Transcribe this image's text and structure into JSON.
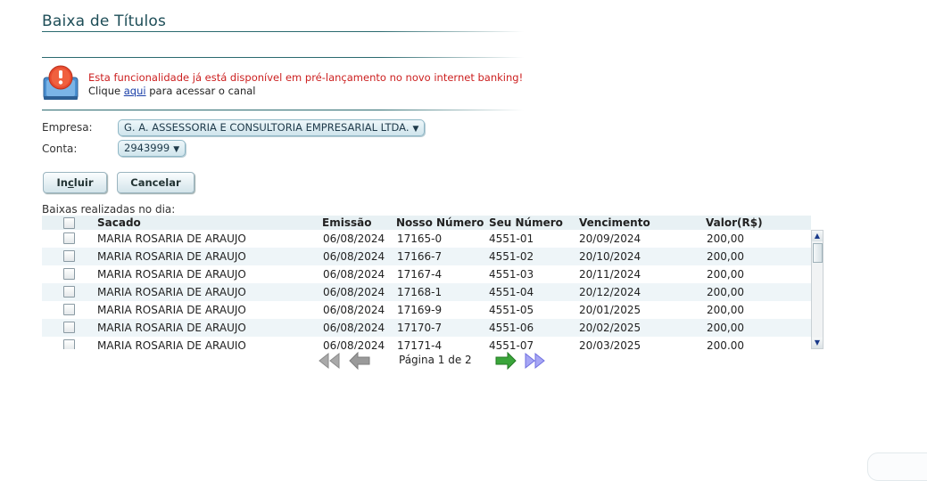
{
  "page": {
    "title": "Baixa de Títulos"
  },
  "notice": {
    "message": "Esta funcionalidade já está disponível em pré-lançamento no novo internet banking!",
    "prefix": "Clique ",
    "link_label": "aqui",
    "suffix": " para acessar o canal"
  },
  "form": {
    "empresa_label": "Empresa:",
    "empresa_value": "G. A. ASSESSORIA E CONSULTORIA EMPRESARIAL LTDA.",
    "conta_label": "Conta:",
    "conta_value": "2943999"
  },
  "buttons": {
    "incluir_prefix": "In",
    "incluir_accel": "c",
    "incluir_suffix": "luir",
    "cancelar": "Cancelar"
  },
  "table": {
    "caption": "Baixas realizadas no dia:",
    "columns": {
      "sacado": "Sacado",
      "emissao": "Emissão",
      "nosso_numero": "Nosso Número",
      "seu_numero": "Seu Número",
      "vencimento": "Vencimento",
      "valor": "Valor(R$)"
    },
    "rows": [
      {
        "sacado": "MARIA ROSARIA DE ARAUJO",
        "emissao": "06/08/2024",
        "nosso_numero": "17165-0",
        "seu_numero": "4551-01",
        "vencimento": "20/09/2024",
        "valor": "200,00"
      },
      {
        "sacado": "MARIA ROSARIA DE ARAUJO",
        "emissao": "06/08/2024",
        "nosso_numero": "17166-7",
        "seu_numero": "4551-02",
        "vencimento": "20/10/2024",
        "valor": "200,00"
      },
      {
        "sacado": "MARIA ROSARIA DE ARAUJO",
        "emissao": "06/08/2024",
        "nosso_numero": "17167-4",
        "seu_numero": "4551-03",
        "vencimento": "20/11/2024",
        "valor": "200,00"
      },
      {
        "sacado": "MARIA ROSARIA DE ARAUJO",
        "emissao": "06/08/2024",
        "nosso_numero": "17168-1",
        "seu_numero": "4551-04",
        "vencimento": "20/12/2024",
        "valor": "200,00"
      },
      {
        "sacado": "MARIA ROSARIA DE ARAUJO",
        "emissao": "06/08/2024",
        "nosso_numero": "17169-9",
        "seu_numero": "4551-05",
        "vencimento": "20/01/2025",
        "valor": "200,00"
      },
      {
        "sacado": "MARIA ROSARIA DE ARAUJO",
        "emissao": "06/08/2024",
        "nosso_numero": "17170-7",
        "seu_numero": "4551-06",
        "vencimento": "20/02/2025",
        "valor": "200,00"
      },
      {
        "sacado": "MARIA ROSARIA DE ARAUJO",
        "emissao": "06/08/2024",
        "nosso_numero": "17171-4",
        "seu_numero": "4551-07",
        "vencimento": "20/03/2025",
        "valor": "200,00"
      }
    ]
  },
  "pagination": {
    "text": "Página 1 de 2"
  },
  "icons": {
    "notice": "exclamation-warning-icon",
    "first": "double-left-arrow-icon",
    "prev": "left-arrow-icon",
    "next": "right-arrow-icon",
    "last": "double-right-arrow-icon"
  },
  "colors": {
    "title": "#1d4d57",
    "notice_text": "#cc1f1f",
    "link": "#1a3fa8",
    "accent_rule": "#2b6a6f",
    "next_arrow": "#3aa53a",
    "last_arrow": "#8c8cf0",
    "disabled_arrow": "#9a9a9a"
  }
}
